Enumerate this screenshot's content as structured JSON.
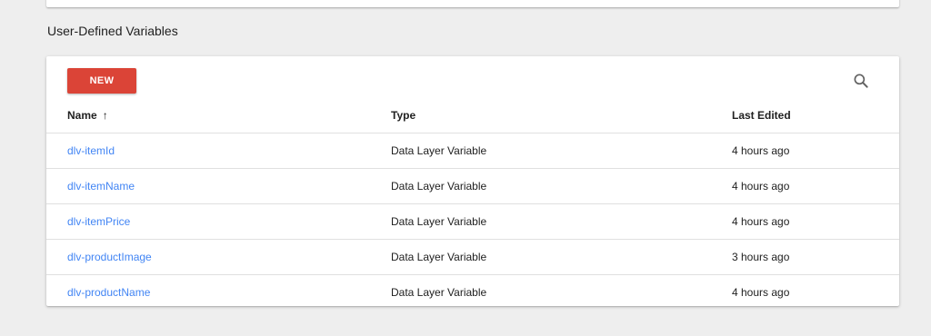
{
  "section": {
    "title": "User-Defined Variables"
  },
  "toolbar": {
    "new_label": "NEW",
    "search_icon": "search-icon"
  },
  "table": {
    "columns": {
      "name": "Name",
      "name_sort_indicator": "↑",
      "type": "Type",
      "last_edited": "Last Edited"
    },
    "rows": [
      {
        "name": "dlv-itemId",
        "type": "Data Layer Variable",
        "last_edited": "4 hours ago"
      },
      {
        "name": "dlv-itemName",
        "type": "Data Layer Variable",
        "last_edited": "4 hours ago"
      },
      {
        "name": "dlv-itemPrice",
        "type": "Data Layer Variable",
        "last_edited": "4 hours ago"
      },
      {
        "name": "dlv-productImage",
        "type": "Data Layer Variable",
        "last_edited": "3 hours ago"
      },
      {
        "name": "dlv-productName",
        "type": "Data Layer Variable",
        "last_edited": "4 hours ago"
      }
    ]
  },
  "colors": {
    "accent_red": "#db4437",
    "link_blue": "#4285f4",
    "background": "#eeeeee"
  }
}
